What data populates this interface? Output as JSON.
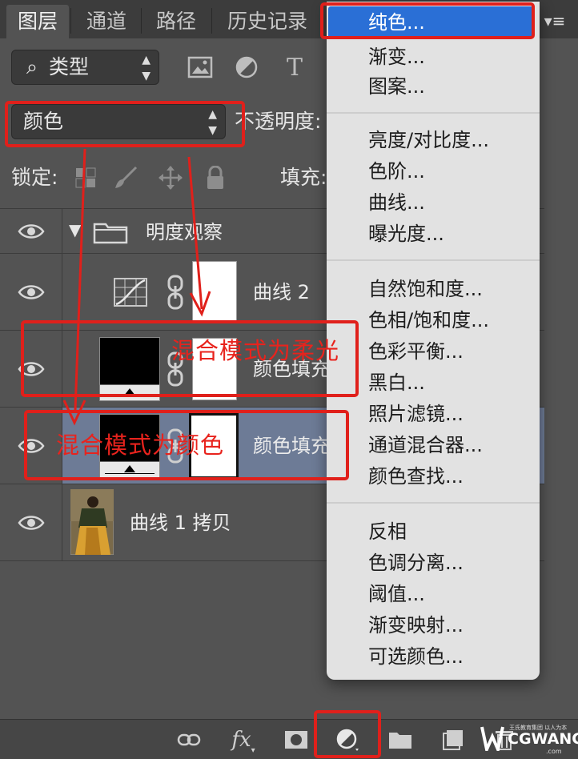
{
  "tabs": [
    "图层",
    "通道",
    "路径",
    "历史记录"
  ],
  "filter": {
    "label": "类型"
  },
  "blend_mode": {
    "value": "颜色"
  },
  "opacity_label": "不透明度:",
  "lock_label": "锁定:",
  "fill_label": "填充:",
  "layers": [
    {
      "name": "明度观察",
      "type": "group"
    },
    {
      "name": "曲线 2",
      "type": "curves"
    },
    {
      "name": "颜色填充",
      "type": "fill"
    },
    {
      "name": "颜色填充",
      "type": "fill",
      "selected": true
    },
    {
      "name": "曲线 1 拷贝",
      "type": "pixel"
    }
  ],
  "menu": {
    "groups": [
      [
        "纯色...",
        "渐变...",
        "图案..."
      ],
      [
        "亮度/对比度...",
        "色阶...",
        "曲线...",
        "曝光度..."
      ],
      [
        "自然饱和度...",
        "色相/饱和度...",
        "色彩平衡...",
        "黑白...",
        "照片滤镜...",
        "通道混合器...",
        "颜色查找..."
      ],
      [
        "反相",
        "色调分离...",
        "阈值...",
        "渐变映射...",
        "可选颜色..."
      ]
    ],
    "selected": "纯色..."
  },
  "annotations": {
    "soft_light": "混合模式为柔光",
    "color_mode": "混合模式为颜色"
  },
  "watermark": {
    "brand": "CGWANG",
    "domain": ".com",
    "slogan": "王氏教育集团 以人为本"
  },
  "colors": {
    "annotation_red": "#e0201b",
    "menu_highlight": "#2a6fd6",
    "panel_bg": "#535353"
  }
}
